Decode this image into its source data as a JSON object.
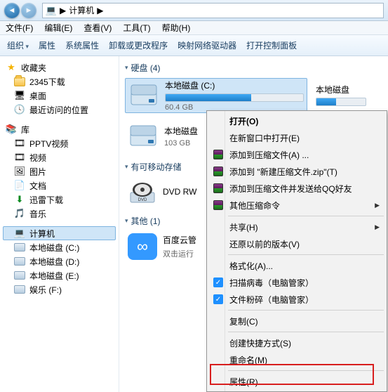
{
  "titlebar": {
    "location_label": "计算机",
    "arrow": "▶"
  },
  "menubar": [
    "文件(F)",
    "编辑(E)",
    "查看(V)",
    "工具(T)",
    "帮助(H)"
  ],
  "toolbar": [
    "组织",
    "属性",
    "系统属性",
    "卸载或更改程序",
    "映射网络驱动器",
    "打开控制面板"
  ],
  "sidebar": {
    "favorites": {
      "label": "收藏夹",
      "items": [
        "2345下载",
        "桌面",
        "最近访问的位置"
      ]
    },
    "libraries": {
      "label": "库",
      "items": [
        "PPTV视频",
        "视频",
        "图片",
        "文档",
        "迅雷下载",
        "音乐"
      ]
    },
    "computer": {
      "label": "计算机",
      "items": [
        "本地磁盘 (C:)",
        "本地磁盘 (D:)",
        "本地磁盘 (E:)",
        "娱乐 (F:)"
      ]
    }
  },
  "content": {
    "hdd_section": "硬盘 (4)",
    "removable_section": "有可移动存储",
    "other_section": "其他 (1)",
    "drives": {
      "c": {
        "name": "本地磁盘 (C:)",
        "size": "60.4 GB",
        "fill_pct": 62
      },
      "c2": {
        "name": "本地磁盘"
      },
      "d": {
        "name": "本地磁盘",
        "size": "103 GB"
      },
      "dvd": {
        "name": "DVD RW"
      },
      "cloud": {
        "name": "百度云管",
        "sub": "双击运行"
      }
    }
  },
  "context_menu": {
    "open": "打开(O)",
    "new_window": "在新窗口中打开(E)",
    "add_archive": "添加到压缩文件(A) ...",
    "add_zip": "添加到 \"新建压缩文件.zip\"(T)",
    "add_qq": "添加到压缩文件并发送给QQ好友",
    "other_archive": "其他压缩命令",
    "share": "共享(H)",
    "restore": "还原以前的版本(V)",
    "format": "格式化(A)...",
    "scan": "扫描病毒（电脑管家）",
    "shred": "文件粉碎（电脑管家）",
    "copy": "复制(C)",
    "shortcut": "创建快捷方式(S)",
    "rename": "重命名(M)",
    "properties": "属性(R)"
  }
}
